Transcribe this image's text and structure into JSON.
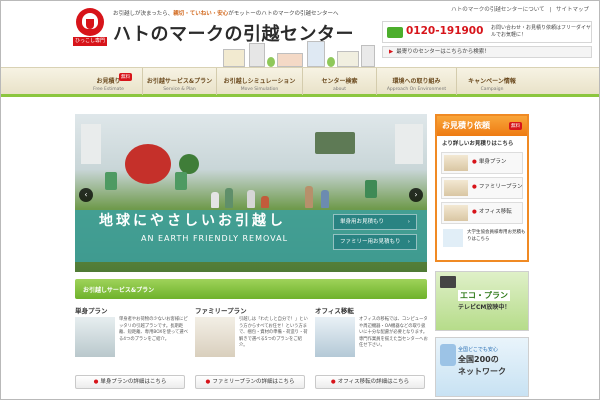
{
  "header": {
    "tagline_parts": [
      "お引越しが決まったら、",
      "親切・ていねい・安心",
      "がモットーのハトのマークの引越センターへ"
    ],
    "logo_label": "ひっこし専門",
    "site_title": "ハトのマークの引越センター",
    "top_links": [
      "ハトのマークの引越センターについて",
      "|",
      "サイトマップ"
    ],
    "phone": "0120-191900",
    "phone_note": "お問い合わせ・お見積り依頼はフリーダイヤルでお気軽に！",
    "nearest_center": "最寄りのセンターはこちらから検索！"
  },
  "nav": [
    {
      "main": "お見積り",
      "sub": "Free Estimate",
      "badge": "無料"
    },
    {
      "main": "お引越サービス&プラン",
      "sub": "Service & Plan"
    },
    {
      "main": "お引越しシミュレーション",
      "sub": "Move Simulation"
    },
    {
      "main": "センター検索",
      "sub": "about"
    },
    {
      "main": "環境への取り組み",
      "sub": "Approach On Environment"
    },
    {
      "main": "キャンペーン情報",
      "sub": "Campaign"
    }
  ],
  "hero": {
    "title": "地球にやさしいお引越し",
    "subtitle": "AN EARTH FRIENDLY REMOVAL",
    "btn_single": "単身用お見積もり",
    "btn_family": "ファミリー用お見積もり",
    "prev_icon": "‹",
    "next_icon": "›"
  },
  "services": {
    "heading": "お引越しサービス&プラン",
    "cols": [
      {
        "title": "単身プラン",
        "text": "単身者やお荷物の少ないお客様にピッタリの引越プランです。長期距離、短距離、専用BOXを使って選べる4つのプランをご紹介。",
        "link": "単身プランの詳細はこちら"
      },
      {
        "title": "ファミリープラン",
        "text": "引越しは「わたしと自分で！」という方からすべてお任せ！という方まで、梱包・資材の準備・荷造り・荷解きで選べる5つのプランをご紹介。",
        "link": "ファミリープランの詳細はこちら"
      },
      {
        "title": "オフィス移転",
        "text": "オフィスの移転では、コンピュータや周辺機器・OA機器などの取り扱いに十分な配慮が必要となります。専門作業員を揃えた当センターへお任せ下さい。",
        "link": "オフィス移転の詳細はこちら"
      }
    ]
  },
  "sidebar": {
    "quote_title": "お見積り依頼",
    "quote_badge": "無料",
    "quote_sub": "より詳しいお見積りはこちら",
    "plans": [
      "単身プラン",
      "ファミリープラン",
      "オフィス移転"
    ],
    "coop": "大学生協会員様専用お見積もりはこちら",
    "eco_title": "エコ・プラン",
    "eco_sub": "テレビCM放映中！",
    "net_line1": "全国どこでも安心",
    "net_line2": "全国200の",
    "net_line3": "ネットワーク"
  },
  "colors": {
    "brand_red": "#d7141a",
    "accent_green": "#8cc63f",
    "accent_orange": "#f08a24",
    "hero_band": "#3ca0a0"
  }
}
